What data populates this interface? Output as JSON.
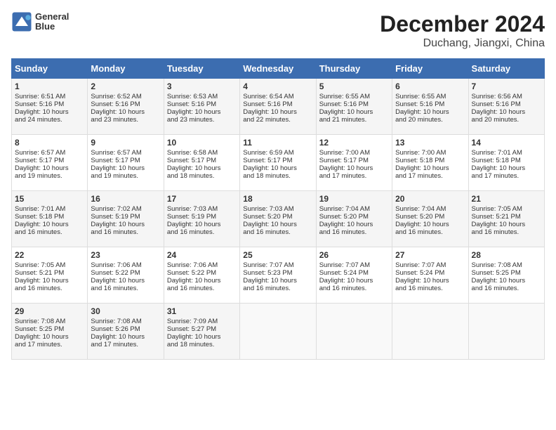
{
  "header": {
    "logo_line1": "General",
    "logo_line2": "Blue",
    "month": "December 2024",
    "location": "Duchang, Jiangxi, China"
  },
  "days_of_week": [
    "Sunday",
    "Monday",
    "Tuesday",
    "Wednesday",
    "Thursday",
    "Friday",
    "Saturday"
  ],
  "weeks": [
    [
      {
        "day": "1",
        "info": "Sunrise: 6:51 AM\nSunset: 5:16 PM\nDaylight: 10 hours\nand 24 minutes."
      },
      {
        "day": "2",
        "info": "Sunrise: 6:52 AM\nSunset: 5:16 PM\nDaylight: 10 hours\nand 23 minutes."
      },
      {
        "day": "3",
        "info": "Sunrise: 6:53 AM\nSunset: 5:16 PM\nDaylight: 10 hours\nand 23 minutes."
      },
      {
        "day": "4",
        "info": "Sunrise: 6:54 AM\nSunset: 5:16 PM\nDaylight: 10 hours\nand 22 minutes."
      },
      {
        "day": "5",
        "info": "Sunrise: 6:55 AM\nSunset: 5:16 PM\nDaylight: 10 hours\nand 21 minutes."
      },
      {
        "day": "6",
        "info": "Sunrise: 6:55 AM\nSunset: 5:16 PM\nDaylight: 10 hours\nand 20 minutes."
      },
      {
        "day": "7",
        "info": "Sunrise: 6:56 AM\nSunset: 5:16 PM\nDaylight: 10 hours\nand 20 minutes."
      }
    ],
    [
      {
        "day": "8",
        "info": "Sunrise: 6:57 AM\nSunset: 5:17 PM\nDaylight: 10 hours\nand 19 minutes."
      },
      {
        "day": "9",
        "info": "Sunrise: 6:57 AM\nSunset: 5:17 PM\nDaylight: 10 hours\nand 19 minutes."
      },
      {
        "day": "10",
        "info": "Sunrise: 6:58 AM\nSunset: 5:17 PM\nDaylight: 10 hours\nand 18 minutes."
      },
      {
        "day": "11",
        "info": "Sunrise: 6:59 AM\nSunset: 5:17 PM\nDaylight: 10 hours\nand 18 minutes."
      },
      {
        "day": "12",
        "info": "Sunrise: 7:00 AM\nSunset: 5:17 PM\nDaylight: 10 hours\nand 17 minutes."
      },
      {
        "day": "13",
        "info": "Sunrise: 7:00 AM\nSunset: 5:18 PM\nDaylight: 10 hours\nand 17 minutes."
      },
      {
        "day": "14",
        "info": "Sunrise: 7:01 AM\nSunset: 5:18 PM\nDaylight: 10 hours\nand 17 minutes."
      }
    ],
    [
      {
        "day": "15",
        "info": "Sunrise: 7:01 AM\nSunset: 5:18 PM\nDaylight: 10 hours\nand 16 minutes."
      },
      {
        "day": "16",
        "info": "Sunrise: 7:02 AM\nSunset: 5:19 PM\nDaylight: 10 hours\nand 16 minutes."
      },
      {
        "day": "17",
        "info": "Sunrise: 7:03 AM\nSunset: 5:19 PM\nDaylight: 10 hours\nand 16 minutes."
      },
      {
        "day": "18",
        "info": "Sunrise: 7:03 AM\nSunset: 5:20 PM\nDaylight: 10 hours\nand 16 minutes."
      },
      {
        "day": "19",
        "info": "Sunrise: 7:04 AM\nSunset: 5:20 PM\nDaylight: 10 hours\nand 16 minutes."
      },
      {
        "day": "20",
        "info": "Sunrise: 7:04 AM\nSunset: 5:20 PM\nDaylight: 10 hours\nand 16 minutes."
      },
      {
        "day": "21",
        "info": "Sunrise: 7:05 AM\nSunset: 5:21 PM\nDaylight: 10 hours\nand 16 minutes."
      }
    ],
    [
      {
        "day": "22",
        "info": "Sunrise: 7:05 AM\nSunset: 5:21 PM\nDaylight: 10 hours\nand 16 minutes."
      },
      {
        "day": "23",
        "info": "Sunrise: 7:06 AM\nSunset: 5:22 PM\nDaylight: 10 hours\nand 16 minutes."
      },
      {
        "day": "24",
        "info": "Sunrise: 7:06 AM\nSunset: 5:22 PM\nDaylight: 10 hours\nand 16 minutes."
      },
      {
        "day": "25",
        "info": "Sunrise: 7:07 AM\nSunset: 5:23 PM\nDaylight: 10 hours\nand 16 minutes."
      },
      {
        "day": "26",
        "info": "Sunrise: 7:07 AM\nSunset: 5:24 PM\nDaylight: 10 hours\nand 16 minutes."
      },
      {
        "day": "27",
        "info": "Sunrise: 7:07 AM\nSunset: 5:24 PM\nDaylight: 10 hours\nand 16 minutes."
      },
      {
        "day": "28",
        "info": "Sunrise: 7:08 AM\nSunset: 5:25 PM\nDaylight: 10 hours\nand 16 minutes."
      }
    ],
    [
      {
        "day": "29",
        "info": "Sunrise: 7:08 AM\nSunset: 5:25 PM\nDaylight: 10 hours\nand 17 minutes."
      },
      {
        "day": "30",
        "info": "Sunrise: 7:08 AM\nSunset: 5:26 PM\nDaylight: 10 hours\nand 17 minutes."
      },
      {
        "day": "31",
        "info": "Sunrise: 7:09 AM\nSunset: 5:27 PM\nDaylight: 10 hours\nand 18 minutes."
      },
      {
        "day": "",
        "info": ""
      },
      {
        "day": "",
        "info": ""
      },
      {
        "day": "",
        "info": ""
      },
      {
        "day": "",
        "info": ""
      }
    ]
  ]
}
